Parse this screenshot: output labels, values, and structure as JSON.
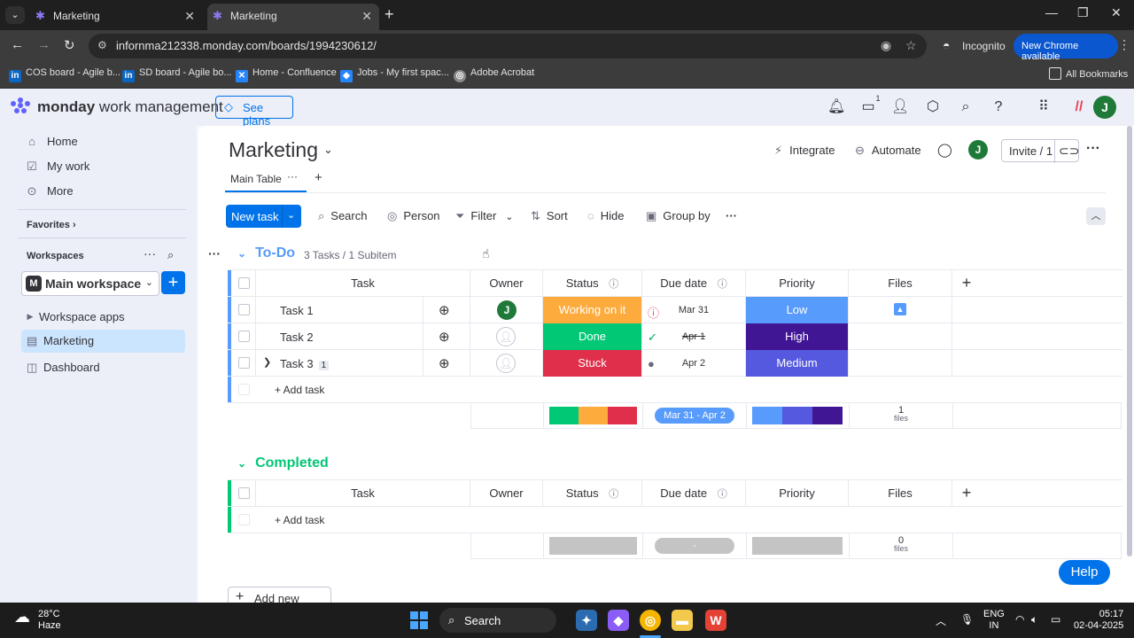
{
  "browser": {
    "tabs": [
      {
        "title": "Marketing"
      },
      {
        "title": "Marketing"
      }
    ],
    "url": "infornma212338.monday.com/boards/1994230612/",
    "incognito_label": "Incognito",
    "new_chrome_label": "New Chrome available",
    "bookmarks": [
      {
        "label": "COS board - Agile b...",
        "icon": "linkedin-icon",
        "color": "#0a66c2"
      },
      {
        "label": "SD board - Agile bo...",
        "icon": "linkedin-icon",
        "color": "#0a66c2"
      },
      {
        "label": "Home - Confluence",
        "icon": "confluence-icon",
        "color": "#2684ff"
      },
      {
        "label": "Jobs - My first spac...",
        "icon": "jira-icon",
        "color": "#2684ff"
      },
      {
        "label": "Adobe Acrobat",
        "icon": "globe-icon",
        "color": "#8a8a8a"
      }
    ],
    "all_bookmarks_label": "All Bookmarks"
  },
  "app": {
    "brand_bold": "monday",
    "brand_rest": "work management",
    "see_plans": "See plans",
    "inbox_badge": "1",
    "user_initial": "J"
  },
  "sidebar": {
    "items": [
      {
        "label": "Home",
        "icon": "home-icon"
      },
      {
        "label": "My work",
        "icon": "checkbox-icon"
      },
      {
        "label": "More",
        "icon": "more-icon"
      }
    ],
    "favorites_label": "Favorites",
    "workspaces_label": "Workspaces",
    "workspace_name": "Main workspace",
    "workspace_initial": "M",
    "tree": [
      {
        "label": "Workspace apps"
      },
      {
        "label": "Marketing"
      },
      {
        "label": "Dashboard"
      }
    ]
  },
  "board": {
    "title": "Marketing",
    "integrate": "Integrate",
    "automate": "Automate",
    "invite": "Invite / 1",
    "view_tab": "Main Table",
    "toolbar": {
      "new_task": "New task",
      "search": "Search",
      "person": "Person",
      "filter": "Filter",
      "sort": "Sort",
      "hide": "Hide",
      "group_by": "Group by"
    },
    "columns": {
      "task": "Task",
      "owner": "Owner",
      "status": "Status",
      "due_date": "Due date",
      "priority": "Priority",
      "files": "Files"
    },
    "add_task": "+ Add task",
    "add_group": "Add new group",
    "groups": [
      {
        "name": "To-Do",
        "count": "3 Tasks / 1 Subitem",
        "color": "#579bfc",
        "rows": [
          {
            "task": "Task 1",
            "owner": "J",
            "status": "Working on it",
            "status_color": "#fdab3d",
            "due": "Mar 31",
            "due_state": "overdue",
            "priority": "Low",
            "priority_color": "#579bfc",
            "files": 1
          },
          {
            "task": "Task 2",
            "owner": "",
            "status": "Done",
            "status_color": "#00c875",
            "due": "Apr 1",
            "due_state": "done",
            "priority": "High",
            "priority_color": "#401694",
            "files": 0
          },
          {
            "task": "Task 3",
            "owner": "",
            "status": "Stuck",
            "status_color": "#df2f4a",
            "due": "Apr 2",
            "due_state": "pending",
            "priority": "Medium",
            "priority_color": "#5559df",
            "files": 0,
            "subitems": "1"
          }
        ],
        "summary": {
          "status_colors": [
            "#00c875",
            "#fdab3d",
            "#df2f4a"
          ],
          "date_range": "Mar 31 - Apr 2",
          "priority_colors": [
            "#579bfc",
            "#5559df",
            "#401694"
          ],
          "files_count": "1",
          "files_label": "files"
        }
      },
      {
        "name": "Completed",
        "color": "#00c875",
        "rows": [],
        "summary": {
          "date_range": "-",
          "files_count": "0",
          "files_label": "files"
        }
      }
    ]
  },
  "help_label": "Help",
  "taskbar": {
    "weather_temp": "28°C",
    "weather_desc": "Haze",
    "search": "Search",
    "lang_1": "ENG",
    "lang_2": "IN",
    "time": "05:17",
    "date": "02-04-2025"
  }
}
